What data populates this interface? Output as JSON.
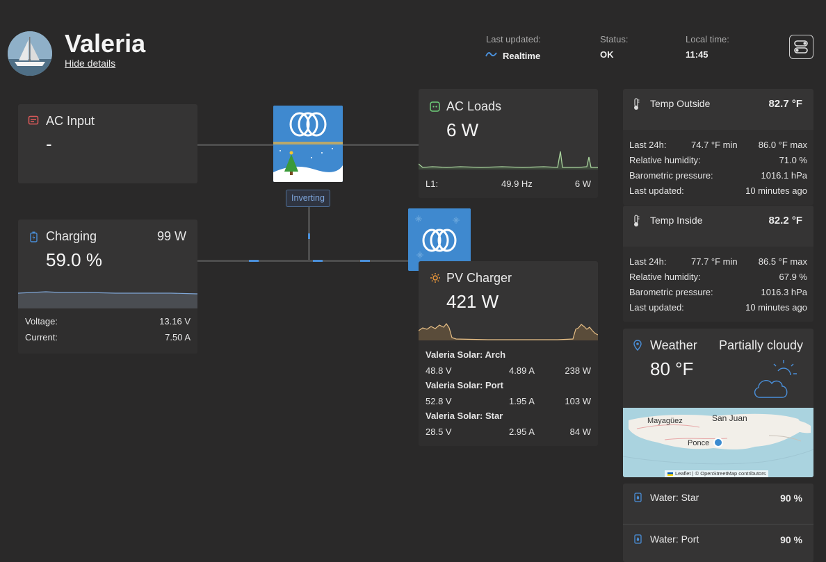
{
  "header": {
    "site_name": "Valeria",
    "hide_details": "Hide details",
    "last_updated_label": "Last updated:",
    "last_updated_value": "Realtime",
    "status_label": "Status:",
    "status_value": "OK",
    "local_time_label": "Local time:",
    "local_time_value": "11:45"
  },
  "ac_input": {
    "title": "AC Input",
    "value": "-"
  },
  "inverter": {
    "state": "Inverting"
  },
  "ac_loads": {
    "title": "AC Loads",
    "value": "6 W",
    "phase_label": "L1:",
    "frequency": "49.9 Hz",
    "phase_power": "6 W"
  },
  "battery": {
    "state": "Charging",
    "power": "99 W",
    "soc": "59.0 %",
    "voltage_label": "Voltage:",
    "voltage": "13.16 V",
    "current_label": "Current:",
    "current": "7.50 A"
  },
  "pv_charger": {
    "title": "PV Charger",
    "value": "421 W",
    "chargers": [
      {
        "name": "Valeria Solar: Arch",
        "voltage": "48.8 V",
        "current": "4.89 A",
        "power": "238 W"
      },
      {
        "name": "Valeria Solar: Port",
        "voltage": "52.8 V",
        "current": "1.95 A",
        "power": "103 W"
      },
      {
        "name": "Valeria Solar: Star",
        "voltage": "28.5 V",
        "current": "2.95 A",
        "power": "84 W"
      }
    ]
  },
  "temp_outside": {
    "title": "Temp Outside",
    "value": "82.7 °F",
    "last24_label": "Last 24h:",
    "min": "74.7 °F min",
    "max": "86.0 °F max",
    "humidity_label": "Relative humidity:",
    "humidity": "71.0 %",
    "pressure_label": "Barometric pressure:",
    "pressure": "1016.1 hPa",
    "updated_label": "Last updated:",
    "updated": "10 minutes ago"
  },
  "temp_inside": {
    "title": "Temp Inside",
    "value": "82.2 °F",
    "last24_label": "Last 24h:",
    "min": "77.7 °F min",
    "max": "86.5 °F max",
    "humidity_label": "Relative humidity:",
    "humidity": "67.9 %",
    "pressure_label": "Barometric pressure:",
    "pressure": "1016.3 hPa",
    "updated_label": "Last updated:",
    "updated": "10 minutes ago"
  },
  "weather": {
    "title": "Weather",
    "condition": "Partially cloudy",
    "temperature": "80 °F",
    "map_labels": {
      "city1": "Mayagüez",
      "city2": "San Juan",
      "city3": "Ponce"
    },
    "attribution": "Leaflet | © OpenStreetMap contributors"
  },
  "tanks": [
    {
      "name": "Water: Star",
      "level": "90 %"
    },
    {
      "name": "Water: Port",
      "level": "90 %"
    }
  ],
  "colors": {
    "background": "#2a2929",
    "card": "#353434",
    "ac_input_icon": "#e05a5a",
    "ac_loads_icon": "#6fcf7a",
    "battery_icon": "#4a8fd9",
    "pv_icon": "#f09a3a",
    "blue_accent": "#4a8fd9"
  }
}
